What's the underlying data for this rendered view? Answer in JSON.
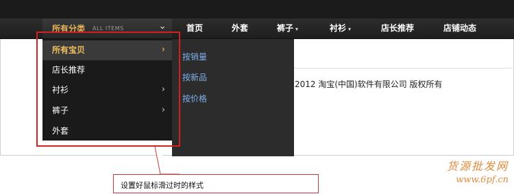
{
  "nav": {
    "category": {
      "label": "所有分类",
      "sub_label": "ALL ITEMS",
      "chevron": "⌄"
    },
    "items": [
      {
        "label": "首页"
      },
      {
        "label": "外套"
      },
      {
        "label": "裤子",
        "caret": "▾"
      },
      {
        "label": "衬衫",
        "caret": "▾"
      },
      {
        "label": "店长推荐"
      },
      {
        "label": "店铺动态"
      }
    ]
  },
  "dropdown": {
    "items": [
      {
        "label": "所有宝贝",
        "arrow": "›",
        "active": true
      },
      {
        "label": "店长推荐"
      },
      {
        "label": "衬衫",
        "arrow": "›"
      },
      {
        "label": "裤子",
        "arrow": "›"
      },
      {
        "label": "外套"
      }
    ],
    "subitems": [
      {
        "label": "按销量"
      },
      {
        "label": "按新品"
      },
      {
        "label": "按价格"
      }
    ]
  },
  "footer": {
    "copyright": "2012 淘宝(中国)软件有限公司 版权所有"
  },
  "annotation": {
    "text": "设置好鼠标滑过时的样式"
  },
  "watermark": {
    "line1": "货源批发网",
    "line2": "www.6pf.cn"
  },
  "colors": {
    "accent": "#e8b35a",
    "link": "#7db0e8",
    "annotation": "#d62020",
    "watermark": "#e08a3c"
  }
}
